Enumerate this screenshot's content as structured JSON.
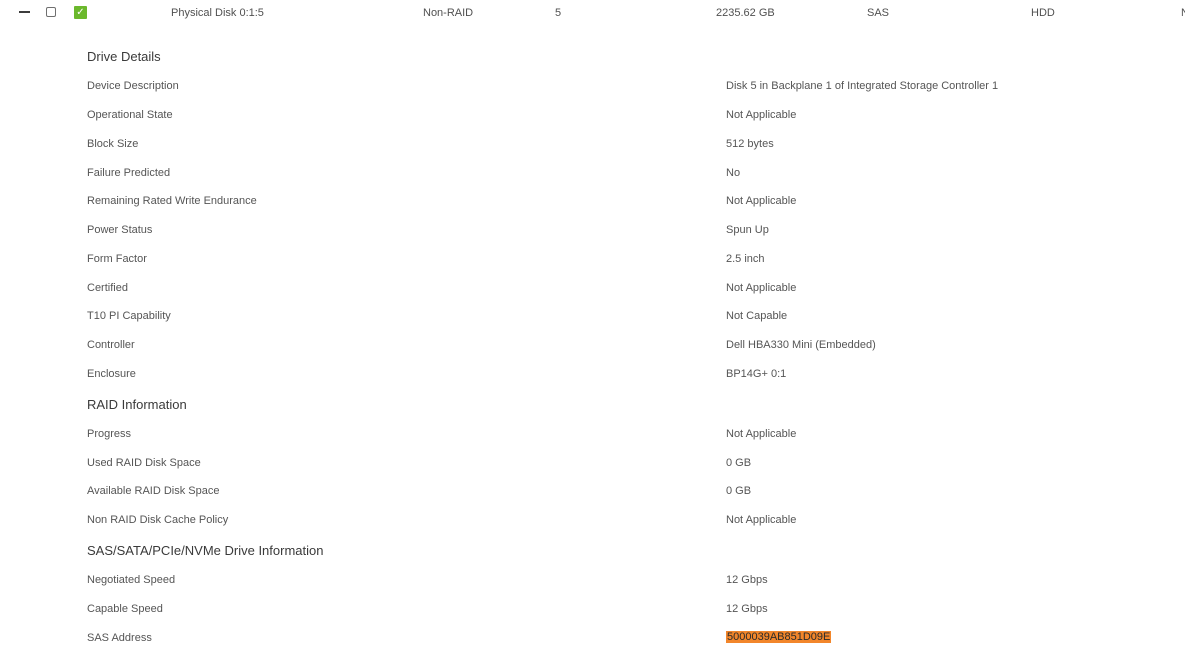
{
  "row": {
    "name": "Physical Disk 0:1:5",
    "raid_type": "Non-RAID",
    "slot": "5",
    "capacity": "2235.62 GB",
    "bus": "SAS",
    "media": "HDD",
    "overflow": "N"
  },
  "drive_details": {
    "title": "Drive Details",
    "items": [
      {
        "label": "Device Description",
        "value": "Disk 5 in Backplane 1 of Integrated Storage Controller 1"
      },
      {
        "label": "Operational State",
        "value": "Not Applicable"
      },
      {
        "label": "Block Size",
        "value": "512 bytes"
      },
      {
        "label": "Failure Predicted",
        "value": "No"
      },
      {
        "label": "Remaining Rated Write Endurance",
        "value": "Not Applicable"
      },
      {
        "label": "Power Status",
        "value": "Spun Up"
      },
      {
        "label": "Form Factor",
        "value": "2.5 inch"
      },
      {
        "label": "Certified",
        "value": "Not Applicable"
      },
      {
        "label": "T10 PI Capability",
        "value": "Not Capable"
      },
      {
        "label": "Controller",
        "value": "Dell HBA330 Mini (Embedded)"
      },
      {
        "label": "Enclosure",
        "value": "BP14G+ 0:1"
      }
    ]
  },
  "raid_info": {
    "title": "RAID Information",
    "items": [
      {
        "label": "Progress",
        "value": "Not Applicable"
      },
      {
        "label": "Used RAID Disk Space",
        "value": "0 GB"
      },
      {
        "label": "Available RAID Disk Space",
        "value": "0 GB"
      },
      {
        "label": "Non RAID Disk Cache Policy",
        "value": "Not Applicable"
      }
    ]
  },
  "drive_info": {
    "title": "SAS/SATA/PCIe/NVMe Drive Information",
    "items": [
      {
        "label": "Negotiated Speed",
        "value": "12 Gbps"
      },
      {
        "label": "Capable Speed",
        "value": "12 Gbps"
      },
      {
        "label": "SAS Address",
        "value": "5000039AB851D09E"
      }
    ]
  },
  "colors": {
    "status_ok": "#6bb82c",
    "highlight": "#f2862b"
  },
  "icons": {
    "collapse": "minus-icon",
    "status": "check-icon"
  }
}
